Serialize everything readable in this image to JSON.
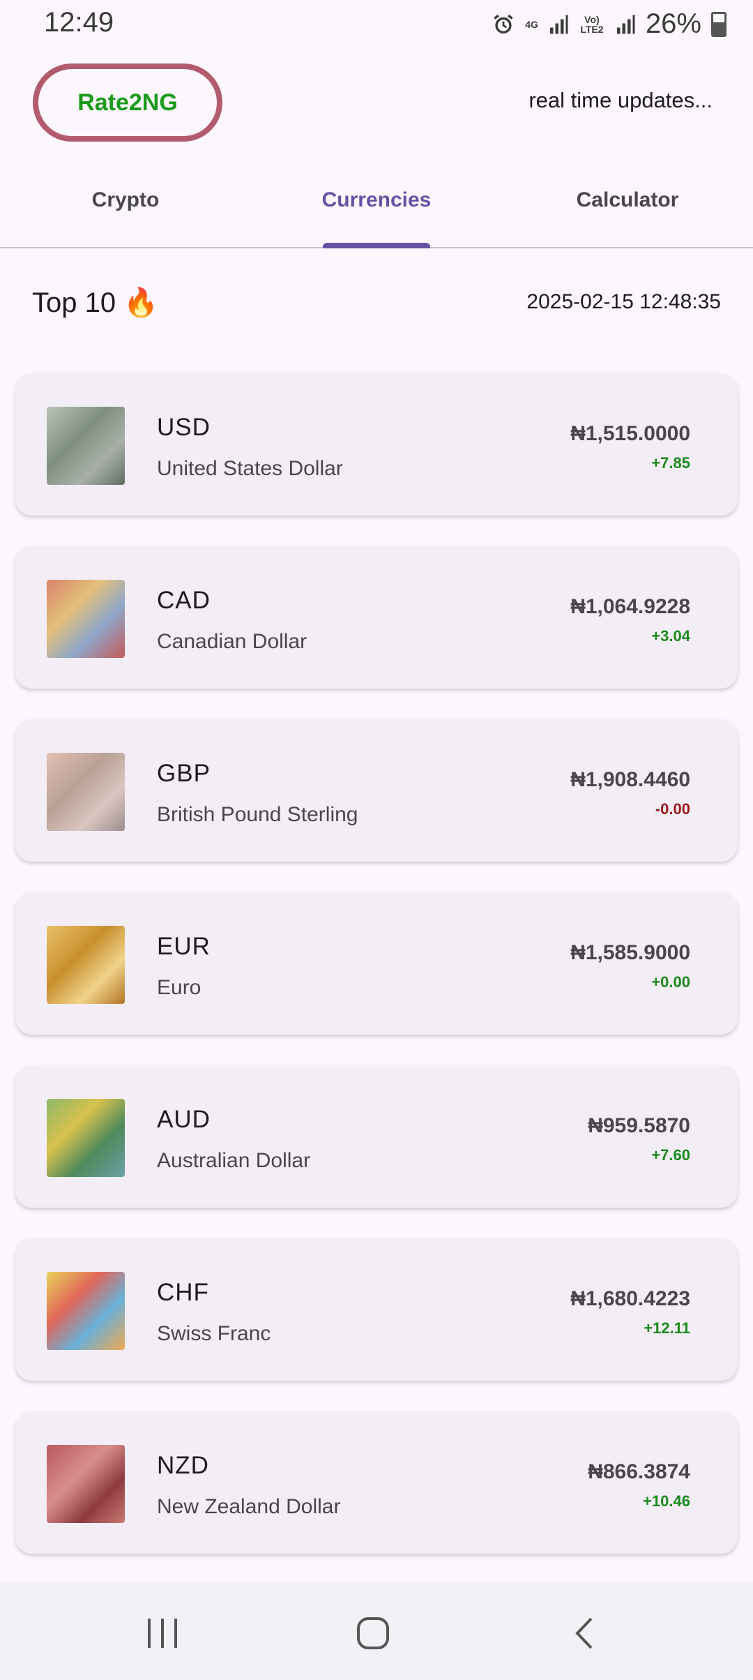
{
  "status_bar": {
    "time": "12:49",
    "network_label": "4G",
    "lte_label": "Vo) LTE2",
    "battery_percent": "26%"
  },
  "header": {
    "brand": "Rate2NG",
    "realtime_text": "real time updates..."
  },
  "tabs": [
    {
      "label": "Crypto",
      "active": false
    },
    {
      "label": "Currencies",
      "active": true
    },
    {
      "label": "Calculator",
      "active": false
    }
  ],
  "section": {
    "title": "Top 10",
    "emoji": "🔥",
    "timestamp": "2025-02-15 12:48:35"
  },
  "currencies": [
    {
      "code": "USD",
      "name": "United States Dollar",
      "price": "₦1,515.0000",
      "change": "+7.85",
      "trend": "up",
      "thumb_color": "#8a9a8a"
    },
    {
      "code": "CAD",
      "name": "Canadian Dollar",
      "price": "₦1,064.9228",
      "change": "+3.04",
      "trend": "up",
      "thumb_color": "#c0876e"
    },
    {
      "code": "GBP",
      "name": "British Pound Sterling",
      "price": "₦1,908.4460",
      "change": "-0.00",
      "trend": "down",
      "thumb_color": "#c8a29a"
    },
    {
      "code": "EUR",
      "name": "Euro",
      "price": "₦1,585.9000",
      "change": "+0.00",
      "trend": "up",
      "thumb_color": "#d4a54a"
    },
    {
      "code": "AUD",
      "name": "Australian Dollar",
      "price": "₦959.5870",
      "change": "+7.60",
      "trend": "up",
      "thumb_color": "#6f9a5a"
    },
    {
      "code": "CHF",
      "name": "Swiss Franc",
      "price": "₦1,680.4223",
      "change": "+12.11",
      "trend": "up",
      "thumb_color": "#d8a85a"
    },
    {
      "code": "NZD",
      "name": "New Zealand Dollar",
      "price": "₦866.3874",
      "change": "+10.46",
      "trend": "up",
      "thumb_color": "#a8575a"
    }
  ],
  "colors": {
    "brand_text": "#1a9a1a",
    "brand_border": "#b35b6e",
    "accent": "#6750a4",
    "positive": "#1a8a1a",
    "negative": "#9a1a1a"
  },
  "nav": {
    "recent_icon": "recent-apps-icon",
    "home_icon": "home-icon",
    "back_icon": "back-icon"
  }
}
